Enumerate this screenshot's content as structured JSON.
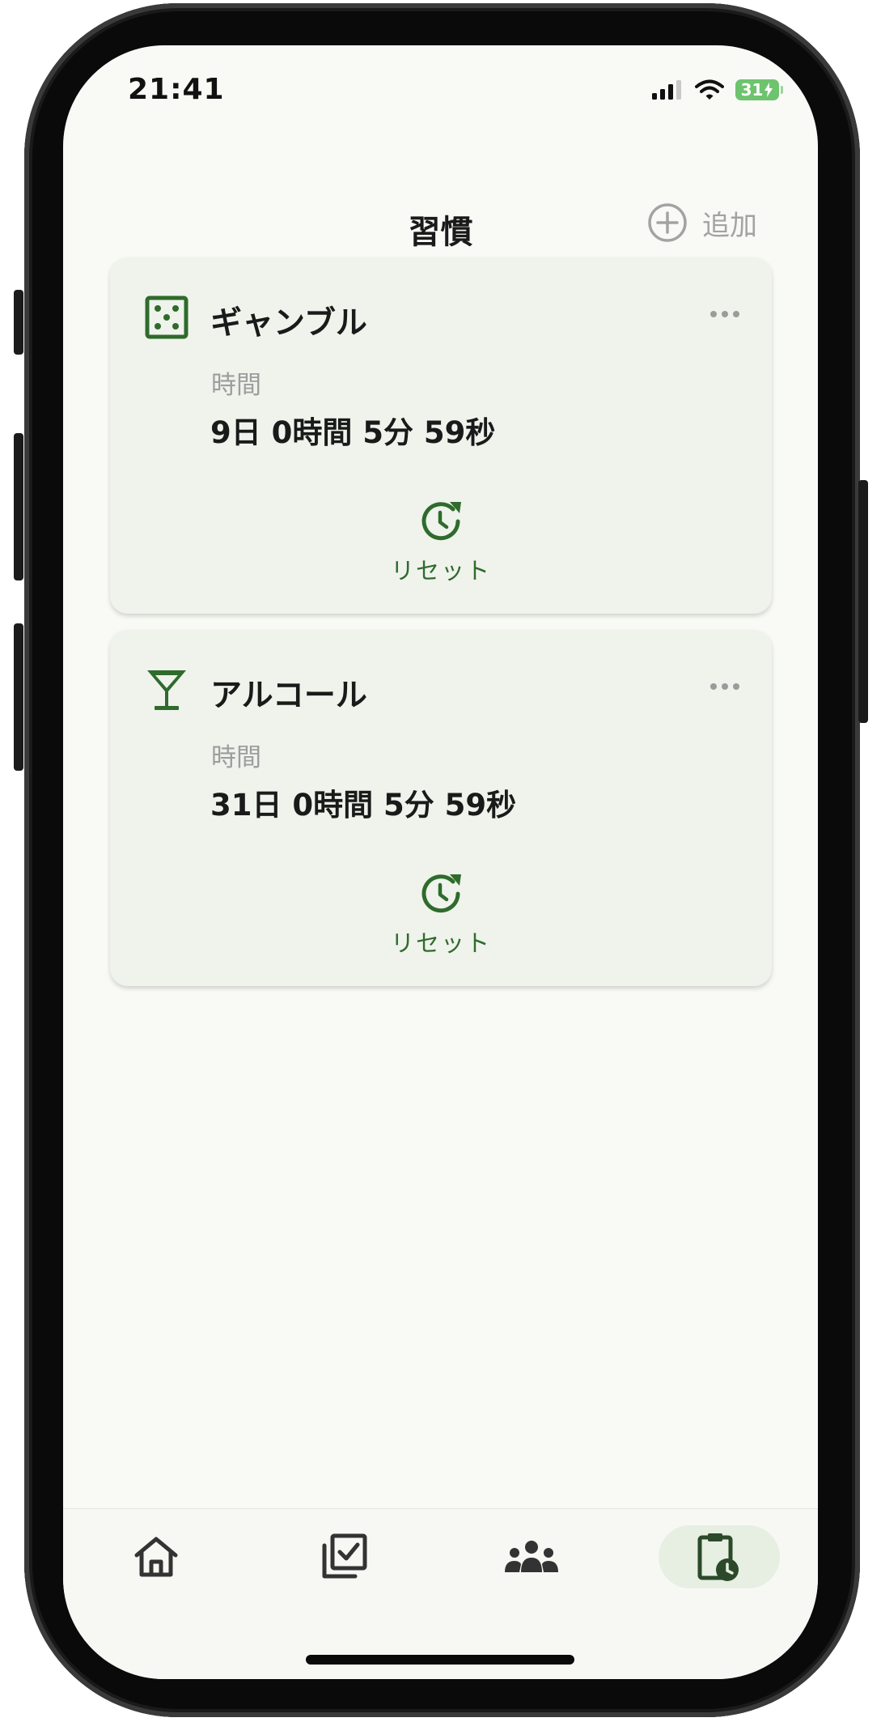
{
  "status_bar": {
    "time": "21:41",
    "battery": "31"
  },
  "header": {
    "title": "習慣",
    "add_label": "追加"
  },
  "habits": [
    {
      "icon": "dice-icon",
      "title": "ギャンブル",
      "label": "時間",
      "value": "9日 0時間 5分 59秒",
      "reset_label": "リセット"
    },
    {
      "icon": "cocktail-glass-icon",
      "title": "アルコール",
      "label": "時間",
      "value": "31日 0時間 5分 59秒",
      "reset_label": "リセット"
    }
  ],
  "tab_bar": {
    "tabs": [
      {
        "icon": "home-icon",
        "active": false
      },
      {
        "icon": "checklist-icon",
        "active": false
      },
      {
        "icon": "group-icon",
        "active": false
      },
      {
        "icon": "clipboard-clock-icon",
        "active": true
      }
    ]
  },
  "colors": {
    "accent": "#2f6b2c",
    "card_background": "#eff3ec",
    "screen_background": "#f9faf5",
    "battery": "#6ec36e"
  }
}
